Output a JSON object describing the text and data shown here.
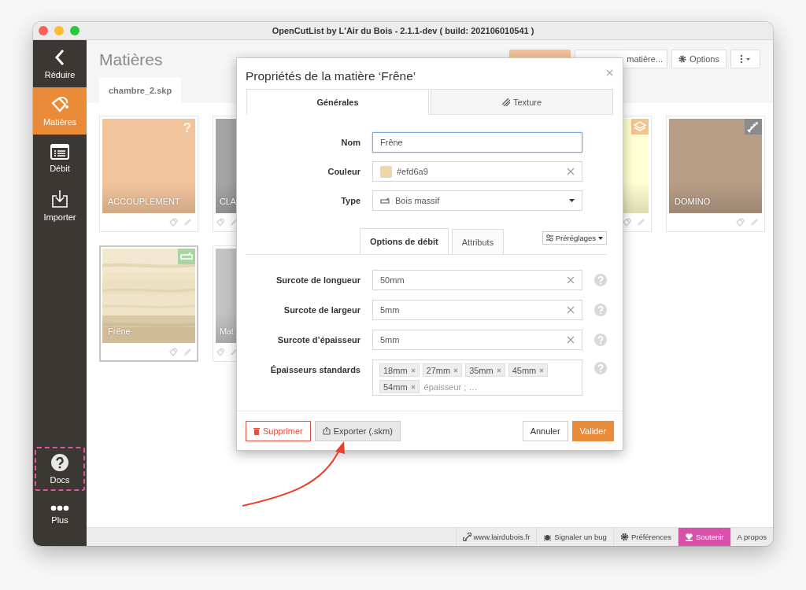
{
  "window": {
    "title": "OpenCutList by L'Air du Bois - 2.1.1-dev ( build: 202106010541 )"
  },
  "sidebar": {
    "items": [
      {
        "label": "Réduire",
        "selected": false,
        "highlighted": false
      },
      {
        "label": "Matières",
        "selected": true,
        "highlighted": false
      },
      {
        "label": "Débit",
        "selected": false,
        "highlighted": false
      },
      {
        "label": "Importer",
        "selected": false,
        "highlighted": false
      },
      {
        "label": "Docs",
        "selected": false,
        "highlighted": true
      },
      {
        "label": "Plus",
        "selected": false,
        "highlighted": false
      }
    ]
  },
  "header": {
    "title": "Matières",
    "toolbar": [
      {
        "kind": "refresh"
      },
      {
        "kind": "new",
        "label": "matière..."
      },
      {
        "kind": "options",
        "label": "Options"
      },
      {
        "kind": "more"
      }
    ],
    "tabs": [
      {
        "label": "chambre_2.skp",
        "selected": true
      }
    ]
  },
  "material_rows": [
    [
      {
        "name": "ACCOUPLEMENT",
        "color": "#f2c49c",
        "kind": "unknown",
        "badge": "?",
        "selected": false
      },
      {
        "name": "CLA",
        "color": "#a6a6a6",
        "selected": false
      },
      {
        "color": "#ffffd2",
        "kind": "sheet",
        "selected": false
      },
      {
        "name": "DOMINO",
        "color": "#b89e86",
        "kind": "hardware",
        "selected": false
      }
    ],
    [
      {
        "name": "Frêne",
        "kind": "solid",
        "selected": true
      },
      {
        "name": "Mat",
        "color": "#c4c4c4",
        "selected": false
      }
    ]
  ],
  "dialog": {
    "title": "Propriétés de la matière ‘Frêne’",
    "tabs": [
      {
        "label": "Générales",
        "selected": true
      },
      {
        "label": "Texture",
        "selected": false
      }
    ],
    "fields": [
      {
        "label": "Nom",
        "kind": "text",
        "value": "Frêne",
        "focused": true
      },
      {
        "label": "Couleur",
        "kind": "color",
        "value": "#efd6a9",
        "color": "#efd6a9",
        "focused": false
      },
      {
        "label": "Type",
        "kind": "select",
        "value": "Bois massif",
        "focused": false
      }
    ],
    "subtabs": [
      {
        "label": "Options de débit",
        "selected": true
      },
      {
        "label": "Attributs",
        "selected": false
      }
    ],
    "presets": "Préréglages",
    "options": [
      {
        "label": "Surcote de longueur",
        "kind": "text",
        "value": "50mm"
      },
      {
        "label": "Surcote de largeur",
        "kind": "text",
        "value": "5mm"
      },
      {
        "label": "Surcote d’épaisseur",
        "kind": "text",
        "value": "5mm"
      },
      {
        "label": "Épaisseurs standards",
        "kind": "tags",
        "tags": [
          "18mm",
          "27mm",
          "35mm",
          "45mm",
          "54mm"
        ],
        "placeholder": "épaisseur ; …"
      }
    ],
    "buttons": [
      {
        "label": "Supprimer",
        "kind": "danger"
      },
      {
        "label": "Exporter (.skm)",
        "kind": "export"
      },
      {
        "label": "Annuler",
        "kind": "default"
      },
      {
        "label": "Valider",
        "kind": "primary"
      }
    ]
  },
  "status_bar": {
    "links": [
      {
        "label": "www.lairdubois.fr",
        "kind": "link"
      },
      {
        "label": "Signaler un bug",
        "kind": "bug"
      },
      {
        "label": "Préférences",
        "kind": "settings"
      },
      {
        "label": "Soutenir",
        "kind": "support"
      },
      {
        "label": "A propos",
        "kind": "about"
      }
    ]
  }
}
